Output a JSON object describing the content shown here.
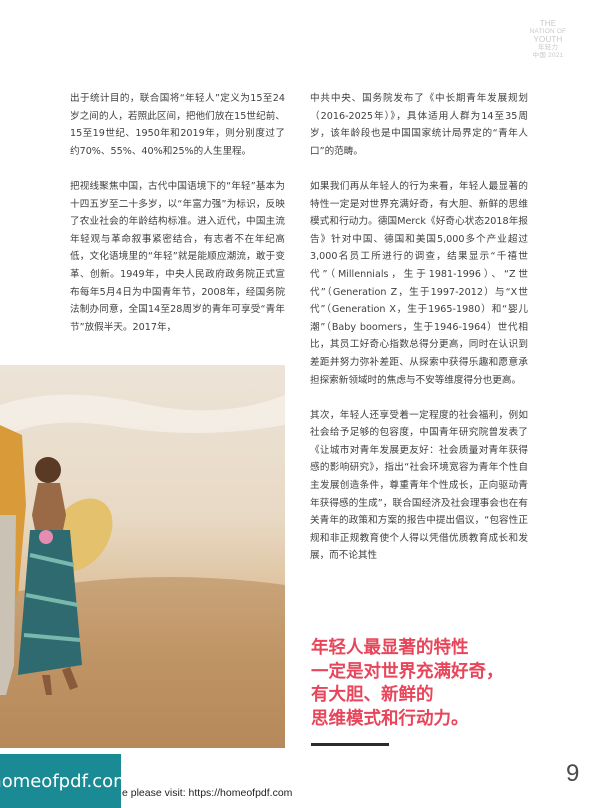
{
  "brand": {
    "line1": "THE",
    "line2": "NATION OF",
    "line3": "YOUTH",
    "line4": "年轻力",
    "line5": "中国 2021"
  },
  "left_column": {
    "paragraphs": [
      "出于统计目的，联合国将“年轻人”定义为15至24岁之间的人，若照此区间，把他们放在15世纪前、15至19世纪、1950年和2019年，则分别度过了约70%、55%、40%和25%的人生里程。",
      "把视线聚焦中国，古代中国语境下的“年轻”基本为十四五岁至二十多岁，以“年富力强”为标识，反映了农业社会的年龄结构标准。进入近代，中国主流年轻观与革命叙事紧密结合，有志者不在年纪高低，文化语境里的“年轻”就是能顺应潮流，敢于变革、创新。1949年，中央人民政府政务院正式宣布每年5月4日为中国青年节，2008年，经国务院法制办同意，全国14至28周岁的青年可享受“青年节”放假半天。2017年，"
    ]
  },
  "right_column": {
    "paragraphs": [
      "中共中央、国务院发布了《中长期青年发展规划（2016-2025年）》，具体适用人群为14至35周岁，该年龄段也是中国国家统计局界定的“青年人口”的范畴。",
      "如果我们再从年轻人的行为来看，年轻人最显著的特性一定是对世界充满好奇，有大胆、新鲜的思维模式和行动力。德国Merck《好奇心状态2018年报告》针对中国、德国和美国5,000多个产业超过3,000名员工所进行的调查，结果显示“千禧世代”（Millennials，生于1981-1996）、“Z世代”（Generation Z，生于1997-2012）与“X世代”（Generation X，生于1965-1980）和“婴儿潮”（Baby boomers，生于1946-1964）世代相比，其员工好奇心指数总得分更高，同时在认识到差距并努力弥补差距、从探索中获得乐趣和愿意承担探索新领域时的焦虑与不安等维度得分也更高。",
      "其次，年轻人还享受着一定程度的社会福利，例如社会给予足够的包容度，中国青年研究院曾发表了《让城市对青年发展更友好：社会质量对青年获得感的影响研究》，指出“社会环境宽容为青年个性自主发展创造条件，尊重青年个性成长，正向驱动青年获得感的生成”，联合国经济及社会理事会也在有关青年的政策和方案的报告中提出倡议，“包容性正规和非正规教育使个人得以凭借优质教育成长和发展，而不论其性"
    ]
  },
  "pull_quote": {
    "lines": [
      "年轻人最显著的特性",
      "一定是对世界充满好奇，",
      "有大胆、新鲜的",
      "思维模式和行动力。"
    ]
  },
  "page_number": "9",
  "watermark": {
    "text": "homeofpdf.com",
    "footer": "e please visit: https://homeofpdf.com"
  },
  "colors": {
    "accent": "#e8455a",
    "watermark_bg": "#1a8a94"
  }
}
